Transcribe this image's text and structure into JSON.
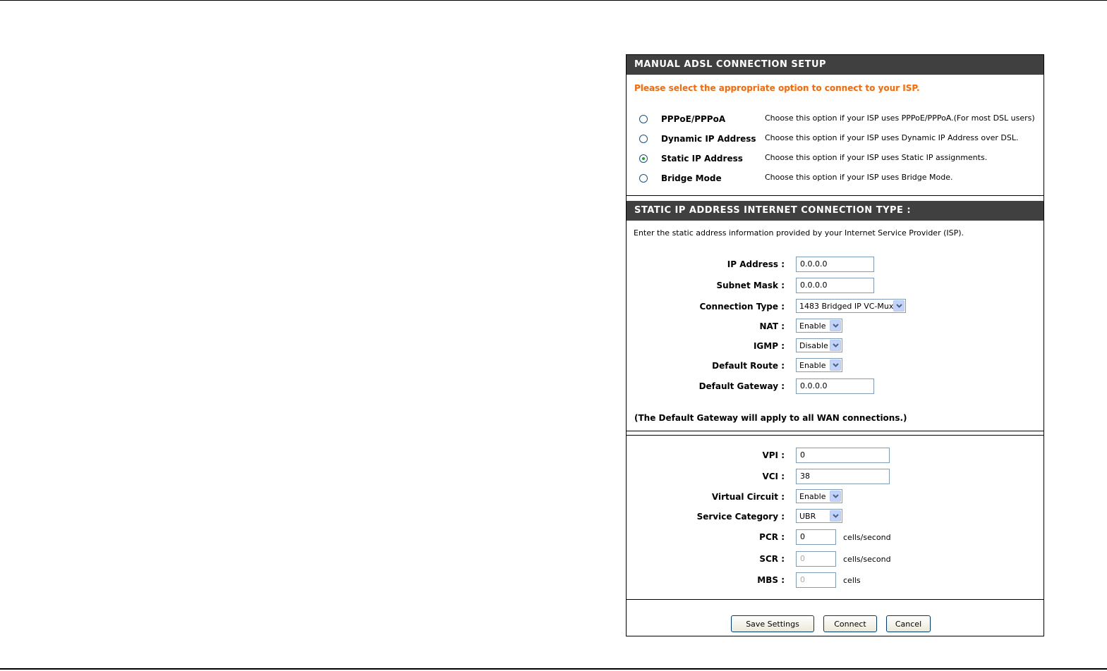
{
  "setup": {
    "title": "MANUAL ADSL CONNECTION SETUP",
    "notice": "Please select the appropriate option to connect to your ISP.",
    "options": [
      {
        "label": "PPPoE/PPPoA",
        "desc": "Choose this option if your ISP uses PPPoE/PPPoA.(For most DSL users)",
        "checked": false
      },
      {
        "label": "Dynamic IP Address",
        "desc": "Choose this option if your ISP uses Dynamic IP Address over DSL.",
        "checked": false
      },
      {
        "label": "Static IP Address",
        "desc": "Choose this option if your ISP uses Static IP assignments.",
        "checked": true
      },
      {
        "label": "Bridge Mode",
        "desc": "Choose this option if your ISP uses Bridge Mode.",
        "checked": false
      }
    ]
  },
  "static": {
    "title": "STATIC IP ADDRESS INTERNET CONNECTION TYPE :",
    "intro": "Enter the static address information provided by your Internet Service Provider (ISP).",
    "ip_label": "IP Address :",
    "ip_value": "0.0.0.0",
    "mask_label": "Subnet Mask :",
    "mask_value": "0.0.0.0",
    "conn_label": "Connection Type :",
    "conn_value": "1483 Bridged IP VC-Mux",
    "nat_label": "NAT :",
    "nat_value": "Enable",
    "igmp_label": "IGMP :",
    "igmp_value": "Disable",
    "route_label": "Default Route :",
    "route_value": "Enable",
    "gateway_label": "Default Gateway :",
    "gateway_value": "0.0.0.0",
    "note": "(The Default Gateway will apply to all WAN connections.)"
  },
  "atm": {
    "vpi_label": "VPI :",
    "vpi_value": "0",
    "vci_label": "VCI :",
    "vci_value": "38",
    "vc_label": "Virtual Circuit :",
    "vc_value": "Enable",
    "svc_label": "Service Category :",
    "svc_value": "UBR",
    "pcr_label": "PCR :",
    "pcr_value": "0",
    "pcr_unit": "cells/second",
    "scr_label": "SCR :",
    "scr_value": "0",
    "scr_unit": "cells/second",
    "mbs_label": "MBS :",
    "mbs_value": "0",
    "mbs_unit": "cells"
  },
  "buttons": {
    "save": "Save Settings",
    "connect": "Connect",
    "cancel": "Cancel"
  },
  "colors": {
    "header_bg": "#404040",
    "notice": "#ff6600",
    "radio_dot": "#21a121"
  }
}
